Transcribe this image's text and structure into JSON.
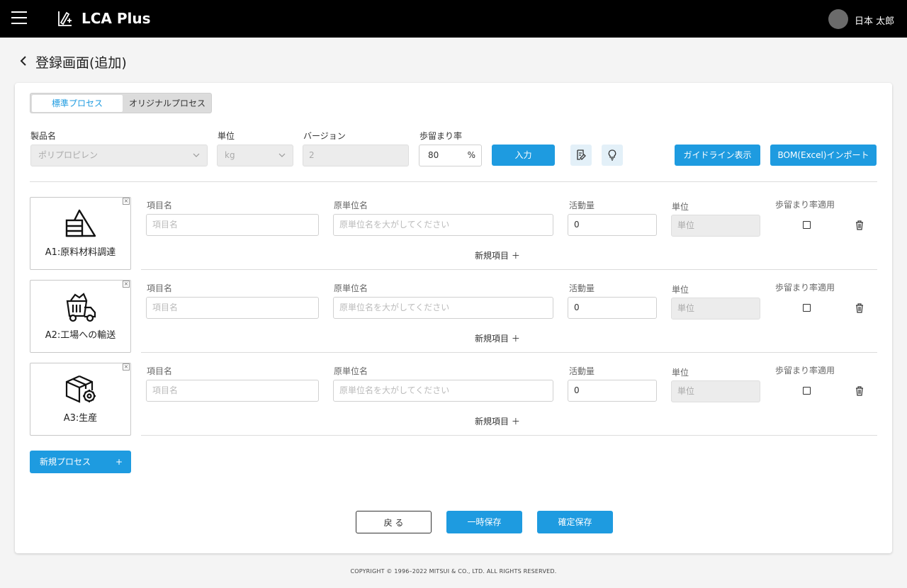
{
  "header": {
    "app_title": "LCA Plus",
    "user_name": "日本 太郎"
  },
  "page": {
    "title": "登録画面(追加)"
  },
  "process_tabs": [
    "標準プロセス",
    "オリジナルプロセス"
  ],
  "form": {
    "product_label": "製品名",
    "product_value": "ポリプロピレン",
    "unit_label": "単位",
    "unit_value": "kg",
    "version_label": "バージョン",
    "version_value": "2",
    "yield_label": "歩留まり率",
    "yield_value": "80",
    "yield_unit": "%",
    "input_button": "入力",
    "guideline_button": "ガイドライン表示",
    "bom_button": "BOM(Excel)インポート"
  },
  "columns": {
    "item_name": "項目名",
    "unit_name": "原単位名",
    "activity": "活動量",
    "unit": "単位",
    "yield_apply": "歩留まり率適用"
  },
  "placeholders": {
    "item_name": "項目名",
    "unit_name": "原単位名を大がしてください",
    "unit": "単位"
  },
  "processes": [
    {
      "name": "A1:原料材料調達",
      "activity": "0",
      "icon": "materials-icon"
    },
    {
      "name": "A2:工場への輸送",
      "activity": "0",
      "icon": "truck-icon"
    },
    {
      "name": "A3:生産",
      "activity": "0",
      "icon": "production-box-icon"
    }
  ],
  "add_item_label": "新規項目 ＋",
  "new_process_button": "新規プロセス",
  "new_process_plus": "+",
  "close_symbol": "×",
  "footer": {
    "back": "戻 る",
    "temp_save": "一時保存",
    "confirm_save": "確定保存",
    "copyright": "COPYRIGHT © 1996–2022 MITSUI & CO., LTD. ALL RIGHTS RESERVED."
  },
  "colors": {
    "accent": "#1e9be0",
    "topbar": "#000000"
  }
}
